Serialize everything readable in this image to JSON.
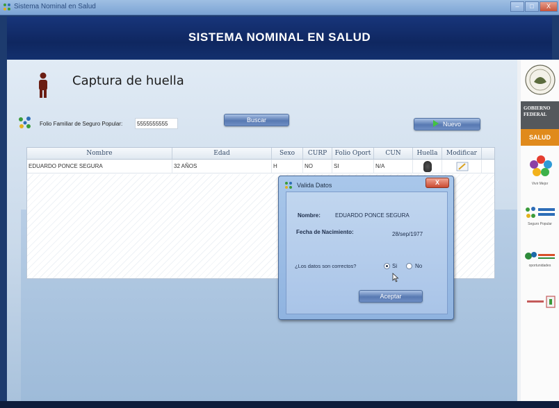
{
  "window": {
    "title": "Sistema Nominal en Salud",
    "min_label": "–",
    "max_label": "□",
    "close_label": "X"
  },
  "banner": {
    "title": "SISTEMA NOMINAL EN SALUD"
  },
  "page": {
    "title": "Captura de huella"
  },
  "search": {
    "folio_label": "Folio Familiar de Seguro Popular:",
    "folio_value": "5555555555",
    "buscar_label": "Buscar",
    "nuevo_label": "Nuevo"
  },
  "grid": {
    "headers": {
      "nombre": "Nombre",
      "edad": "Edad",
      "sexo": "Sexo",
      "curp": "CURP",
      "folio_oport": "Folio Oport",
      "cun": "CUN",
      "huella": "Huella",
      "modificar": "Modificar"
    },
    "rows": [
      {
        "nombre": "EDUARDO PONCE SEGURA",
        "edad": "32 AÑOS",
        "sexo": "H",
        "curp": "NO",
        "folio_oport": "SI",
        "cun": "N/A"
      }
    ]
  },
  "dialog": {
    "title": "Valida Datos",
    "close_label": "X",
    "nombre_label": "Nombre:",
    "nombre_value": "EDUARDO PONCE SEGURA",
    "fecha_label": "Fecha de Nacimiento:",
    "fecha_value": "28/sep/1977",
    "question": "¿Los datos son correctos?",
    "option_si": "Si",
    "option_no": "No",
    "selected": "Si",
    "aceptar_label": "Aceptar"
  },
  "sidebar": {
    "gobierno": "GOBIERNO FEDERAL",
    "salud": "SALUD",
    "vivir_mejor": "Vivir Mejor",
    "seguro_popular": "Seguro Popular",
    "oportunidades": "oportunidades"
  }
}
